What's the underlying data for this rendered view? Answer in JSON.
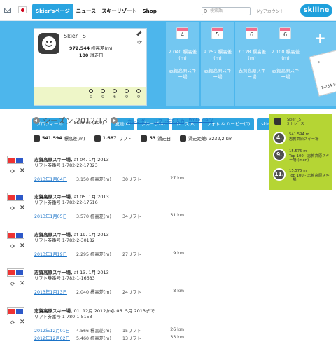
{
  "header": {
    "nav": [
      "Skier'sページ",
      "ニュース",
      "スキーリゾート",
      "Shop"
    ],
    "search_placeholder": "検索語",
    "account": "Myアカウント",
    "logo": "skiline"
  },
  "profile": {
    "name": "Skier _S",
    "stat_vertical_value": "972.544",
    "stat_vertical_label": "標高差(m)",
    "stat_days_value": "100",
    "stat_days_label": "滑走日",
    "mini": [
      "0",
      "0",
      "6",
      "0",
      "0"
    ]
  },
  "day_cards": [
    {
      "day": "4",
      "value": "2.040 標高差(m)",
      "resort": "志賀高原スキー場"
    },
    {
      "day": "5",
      "value": "9.252 標高差(m)",
      "resort": "志賀高原スキー場"
    },
    {
      "day": "6",
      "value": "7.128 標高差(m)",
      "resort": "志賀高原スキー場"
    },
    {
      "day": "6",
      "value": "2.100 標高差(m)",
      "resort": "志賀高原スキー場"
    }
  ],
  "ticket_text": "1-234-56-7",
  "tabs": [
    "プロフィール",
    "Skilines (100)",
    "友達(0)",
    "グループ(0)",
    "レース(6)",
    "フォト & ムービー(0)",
    "skimovies (0)"
  ],
  "season": {
    "title": "シーズン 2012/13",
    "links": [
      "カレンダー",
      "リフト券を入力",
      "Write diary"
    ],
    "summary": {
      "vertical": "541.594",
      "vertical_label": "標高差(m)",
      "lifts": "1.687",
      "lifts_label": "リフト",
      "days": "53",
      "days_label": "滑走日",
      "distance_label": "滑走距離: 3232,2 km"
    }
  },
  "entries": [
    {
      "title": "志賀高原スキー場,",
      "date": " at 04. 1月 2013",
      "ticket": "リフト券番号 1-782-22-17323",
      "rows": [
        [
          "2013年1月04日",
          "3.150 標高差(m)",
          "30リフト",
          "27 km"
        ]
      ]
    },
    {
      "title": "志賀高原スキー場,",
      "date": " at 05. 1月 2013",
      "ticket": "リフト券番号 1-782-22-17516",
      "rows": [
        [
          "2013年1月05日",
          "3.570 標高差(m)",
          "34リフト",
          "31 km"
        ]
      ]
    },
    {
      "title": "志賀高原スキー場,",
      "date": " at 19. 1月 2013",
      "ticket": "リフト券番号 1-782-2-30182",
      "rows": [
        [
          "2013年1月19日",
          "2.295 標高差(m)",
          "27リフト",
          "9 km"
        ]
      ]
    },
    {
      "title": "志賀高原スキー場,",
      "date": " at 13. 1月 2013",
      "ticket": "リフト券番号 1-782-1-16683",
      "rows": [
        [
          "2013年1月13日",
          "2.040 標高差(m)",
          "24リフト",
          "8 km"
        ]
      ]
    },
    {
      "title": "志賀高原スキー場,",
      "date": " 01. 12月 2012から 06. 5月 2013まで",
      "ticket": "リフト券番号 1-780-1-5153",
      "rows": [
        [
          "2012年12月01日",
          "4.566 標高差(m)",
          "15リフト",
          "26 km"
        ],
        [
          "2012年12月02日",
          "5.460 標高差(m)",
          "13リフト",
          "33 km"
        ]
      ]
    }
  ],
  "green_panel": {
    "name": "Skier _S",
    "sub": "3 トレース",
    "items": [
      {
        "rank": "4.",
        "line1": "541.594 m",
        "line2": "志賀高原スキー場"
      },
      {
        "rank": "9.",
        "line1": "15.575 m",
        "line2": "Top 100 - 志賀高原スキー場 (men)"
      },
      {
        "rank": "11.",
        "line1": "15.575 m",
        "line2": "Top 100 - 志賀高原スキー場"
      }
    ]
  }
}
